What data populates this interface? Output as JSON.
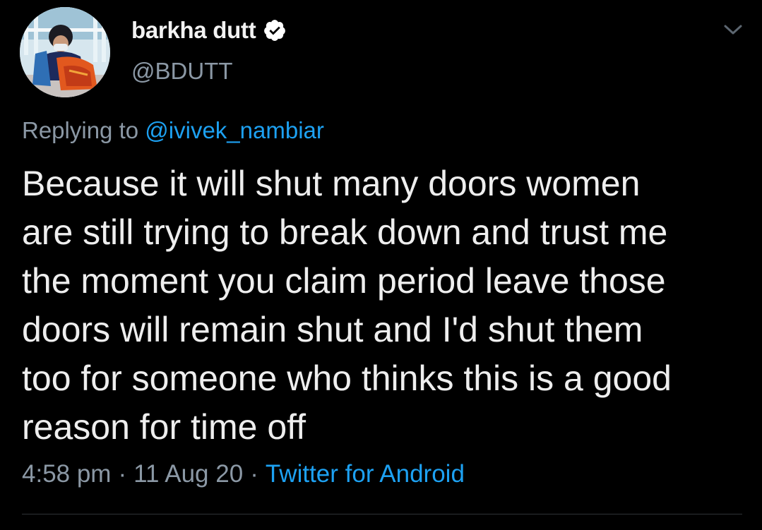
{
  "colors": {
    "background": "#000000",
    "text_primary": "#eeeeee",
    "text_secondary": "#8b98a5",
    "link": "#1da1f2",
    "verified_badge": "#ffffff",
    "divider": "#2f3336"
  },
  "author": {
    "display_name": "barkha dutt",
    "handle": "@BDUTT",
    "verified": true,
    "verified_icon": "verified-badge-icon",
    "avatar_icon": "profile-photo"
  },
  "menu": {
    "icon": "chevron-down-icon"
  },
  "reply": {
    "prefix": "Replying to",
    "to_handle": "@ivivek_nambiar"
  },
  "tweet": {
    "text": "Because it will shut many doors women\nare still trying to break down and trust me\nthe moment you claim period leave those\ndoors will remain shut and I'd shut them\ntoo for someone who thinks this is a good\nreason for time off"
  },
  "meta": {
    "time": "4:58 pm",
    "separator": "·",
    "date": "11 Aug 20",
    "source": "Twitter for Android"
  }
}
